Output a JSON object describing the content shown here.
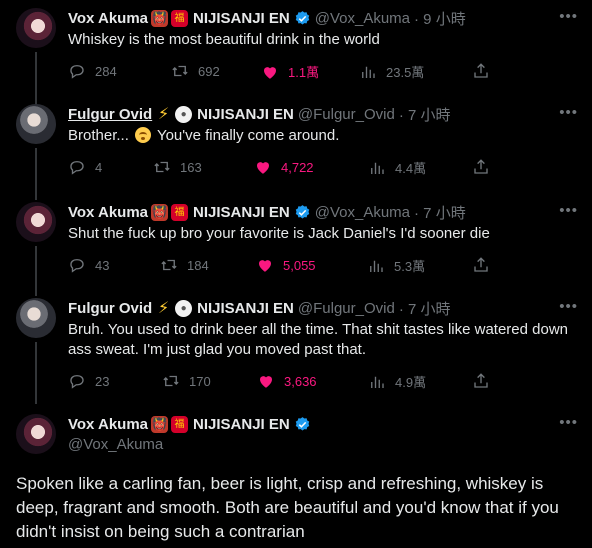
{
  "tweets": [
    {
      "name": "Vox Akuma",
      "org": "NIJISANJI EN",
      "handle": "@Vox_Akuma",
      "time": "· 9 小時",
      "text": "Whiskey is the most beautiful drink in the world",
      "replies": "284",
      "retweets": "692",
      "likes": "1.1萬",
      "views": "23.5萬"
    },
    {
      "name": "Fulgur Ovid",
      "org": "NIJISANJI EN",
      "handle": "@Fulgur_Ovid",
      "time": "· 7 小時",
      "text_before": "Brother...",
      "text_after": "You've finally come around.",
      "replies": "4",
      "retweets": "163",
      "likes": "4,722",
      "views": "4.4萬"
    },
    {
      "name": "Vox Akuma",
      "org": "NIJISANJI EN",
      "handle": "@Vox_Akuma",
      "time": "· 7 小時",
      "text": "Shut the fuck up bro your favorite is Jack Daniel's I'd sooner die",
      "replies": "43",
      "retweets": "184",
      "likes": "5,055",
      "views": "5.3萬"
    },
    {
      "name": "Fulgur Ovid",
      "org": "NIJISANJI EN",
      "handle": "@Fulgur_Ovid",
      "time": "· 7 小時",
      "text": "Bruh. You used to drink beer all the time. That shit tastes like watered down ass sweat. I'm just glad you moved past that.",
      "replies": "23",
      "retweets": "170",
      "likes": "3,636",
      "views": "4.9萬"
    }
  ],
  "main_tweet": {
    "name": "Vox Akuma",
    "org": "NIJISANJI EN",
    "handle": "@Vox_Akuma",
    "text": "Spoken like a carling fan, beer is light, crisp and refreshing, whiskey is deep, fragrant and smooth. Both are beautiful and you'd know that if you didn't insist on being such a contrarian"
  },
  "icons": {
    "more": "more-dots-icon",
    "reply": "reply-icon",
    "retweet": "retweet-icon",
    "like": "heart-icon",
    "views": "views-icon",
    "share": "share-icon",
    "verified": "verified-badge-icon"
  },
  "colors": {
    "background": "#000000",
    "text": "#e7e9ea",
    "muted": "#71767b",
    "like": "#f91880",
    "verified": "#1d9bf0"
  }
}
